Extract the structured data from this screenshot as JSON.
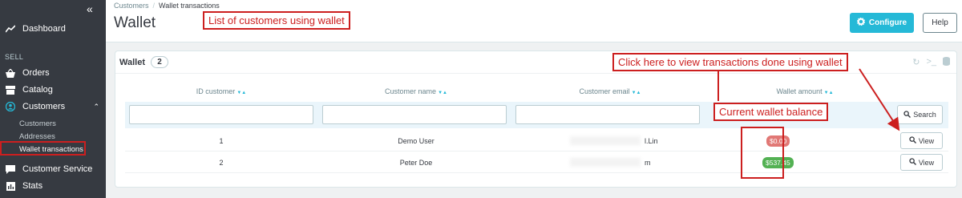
{
  "sidebar": {
    "collapse_glyph": "«",
    "dashboard": "Dashboard",
    "section_sell": "SELL",
    "orders": "Orders",
    "catalog": "Catalog",
    "customers": "Customers",
    "sub_customers": "Customers",
    "sub_addresses": "Addresses",
    "sub_wallet": "Wallet transactions",
    "customer_service": "Customer Service",
    "stats": "Stats"
  },
  "header": {
    "breadcrumb_root": "Customers",
    "breadcrumb_sep": "/",
    "breadcrumb_current": "Wallet transactions",
    "title": "Wallet",
    "configure_label": "Configure",
    "help_label": "Help"
  },
  "panel": {
    "title": "Wallet",
    "count": "2",
    "columns": [
      "ID customer",
      "Customer name",
      "Customer email",
      "Wallet amount"
    ],
    "search_label": "Search",
    "rows": [
      {
        "id": "1",
        "name": "Demo User",
        "email_tail": "l.Lin",
        "amount": "$0.00",
        "amount_color": "#e17875",
        "view": "View"
      },
      {
        "id": "2",
        "name": "Peter Doe",
        "email_tail": "m",
        "amount": "$537.45",
        "amount_color": "#53b153",
        "view": "View"
      }
    ]
  },
  "annotations": {
    "list_note": "List of customers using wallet",
    "view_note": "Click here to view transactions done using wallet",
    "balance_note": "Current wallet balance",
    "color": "#cc1f1f"
  },
  "icons": [
    "chart-icon",
    "basket-icon",
    "store-icon",
    "person-icon",
    "chat-icon",
    "stats-icon",
    "gear-icon",
    "refresh-icon",
    "terminal-icon",
    "database-icon",
    "zoom-icon"
  ]
}
